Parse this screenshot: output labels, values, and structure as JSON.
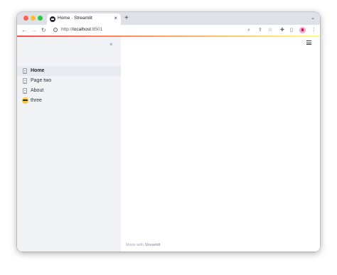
{
  "browser": {
    "tab": {
      "title": "Home · Streamlit",
      "close_glyph": "×"
    },
    "new_tab_glyph": "+",
    "tab_menu_glyph": "⌄",
    "nav": {
      "back_glyph": "←",
      "forward_glyph": "→",
      "reload_glyph": "↻"
    },
    "url": {
      "scheme": "http://",
      "host": "localhost",
      "port": ":8501"
    },
    "toolbar_icons": {
      "zoom": "⌕",
      "share": "⇪",
      "bookmark": "☆",
      "extensions": "✚",
      "sidepanel": "▯",
      "menu": "⋮"
    }
  },
  "sidebar": {
    "close_glyph": "×",
    "items": [
      {
        "label": "Home",
        "icon": "page-icon",
        "active": true
      },
      {
        "label": "Page two",
        "icon": "page-icon",
        "active": false
      },
      {
        "label": "About",
        "icon": "page-icon",
        "active": false
      },
      {
        "label": "three",
        "icon": "sunglasses-emoji-icon",
        "active": false
      }
    ]
  },
  "footer": {
    "prefix": "Made with",
    "brand": "Streamlit"
  },
  "colors": {
    "sidebar_bg": "#f0f2f6",
    "accent_start": "#ff4b4b",
    "accent_end": "#fffd80"
  }
}
